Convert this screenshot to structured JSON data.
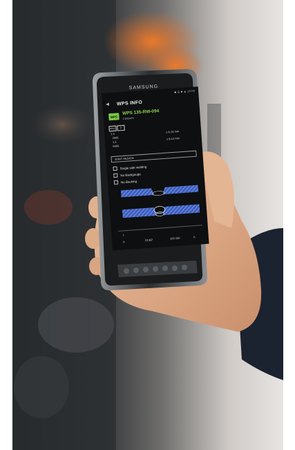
{
  "screen": {
    "app_title": "WPS INFO",
    "status_text": "◆ ◎ ■ ▲ 14:02",
    "badge": "WPS",
    "wps_code": "WPS 135-RW-094",
    "wps_subtitle": "2 passes",
    "param_chip_1": "MAG",
    "param_chip_2": "P",
    "param_line_1": "1.3",
    "param_line_2": "2505",
    "param_line_3": "1.3",
    "param_line_4": "5005",
    "param_right_1": "≥ 8-14 mm",
    "param_right_2": "≤ 8-14 mm",
    "joint_button_label": "JOINT DESIGN",
    "rows": [
      "Single side welding",
      "No Backgouge",
      "No Backing"
    ],
    "footer_left": "A",
    "footer_mid": "DCEP",
    "footer_right": "100-150",
    "footer_unit": "A",
    "colors": {
      "screen_bg": "#0d0f10",
      "accent_green": "#7ac943",
      "plate_blue": "#4a6fd6"
    },
    "icons": [
      "back-arrow-icon",
      "weld-joint-icon",
      "gas-icon",
      "position-icon"
    ]
  }
}
